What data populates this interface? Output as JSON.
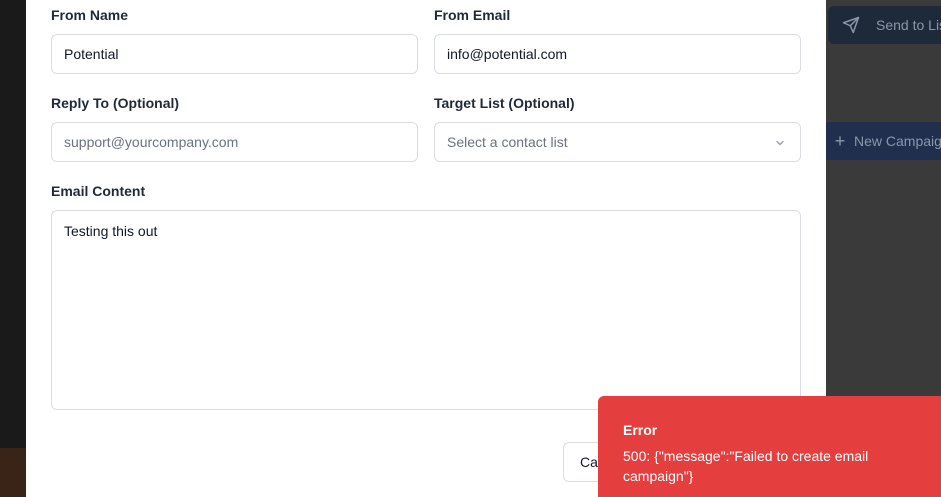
{
  "background": {
    "send_button_label": "Send to List",
    "new_campaign_label": "New Campaign"
  },
  "form": {
    "from_name": {
      "label": "From Name",
      "value": "Potential"
    },
    "from_email": {
      "label": "From Email",
      "value": "info@potential.com"
    },
    "reply_to": {
      "label": "Reply To (Optional)",
      "placeholder": "support@yourcompany.com"
    },
    "target_list": {
      "label": "Target List (Optional)",
      "placeholder": "Select a contact list"
    },
    "email_content": {
      "label": "Email Content",
      "value": "Testing this out"
    },
    "cancel_label": "Cancel"
  },
  "toast": {
    "title": "Error",
    "message": "500: {\"message\":\"Failed to create email campaign\"}",
    "color": "#e53e3e"
  }
}
